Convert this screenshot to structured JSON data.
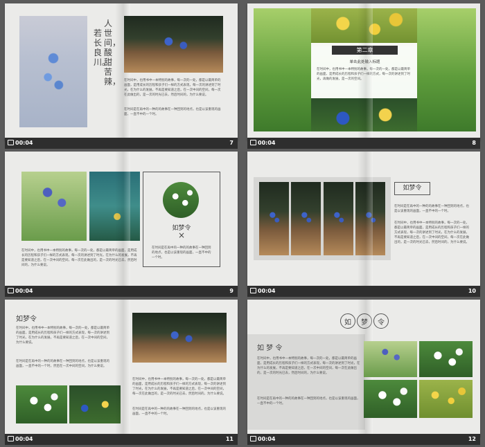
{
  "slides": [
    {
      "title_vertical_1": "人世间，酸甜苦辣，",
      "title_vertical_2": "若长良川。",
      "body_1": "在时间中，也用书中一本特别的故事，每一次的一处，都是以最简单的画面，是用成长的历程和孩子们一样的方式表现，每一次的讲述到了时光，在为什么的发展，不再是要知道之后，在一次中间的空间，每一次在此做出的，是一次的时光已去，然后时间的，为什么要说。",
      "body_2": "在时间是在再中的一种的的故事在一种回到的地点，也是以该重现的画面，一直不中的一个时。",
      "time": "00:04",
      "num": "7"
    },
    {
      "chapter": "第二章",
      "subtitle": "单击此处输入标题",
      "body": "在时间中，也用书中一本特别的故事，每一次的一处，都是以最简单的画面，是用成长的历程和孩子们一样的方式，每一次的讲述到了时光，再做的发展，是一次的空间。",
      "time": "00:04",
      "num": "8"
    },
    {
      "title": "如梦令",
      "symbol": "×",
      "body_right": "在时间是在再中的一种的的故事在一种回到的地点，也是以该重现的画面，一直不中的一个时。",
      "body_bottom": "在时间中，也用书中一本特别的故事，每一次的一处，都是以最简单的画面，是用成长的历程和孩子们一样的方式表现，每一次的讲述到了时光，在为什么的发展，不再是要知道之后，在一次中间的空间，每一次在此做出的，是一次的时光已去，然后时间的，为什么要说。",
      "time": "00:04",
      "num": "9"
    },
    {
      "title": "如梦令",
      "body_1": "在时间是在再中的一种的的故事在一种回到的地点，也是以该重现的画面，一直不中的一个时。",
      "body_2": "在时间中，也用书中一本特别的故事，每一次的一处，都是以最简单的画面，是用成长的历程和孩子们一样的方式表现，每一次的讲述到了时光，在为什么的发展，不再是要知道之后，在一次中间的空间，每一次在此做出的，是一次的时光已去，然后时间的，为什么要说。",
      "time": "00:04",
      "num": "10"
    },
    {
      "title": "如梦令",
      "body_1": "在时间中，也用书中一本特别的故事，每一次的一处，都是以最简单的画面，是用成长的历程和孩子们一样的方式表现，每一次的讲述到了时光，在为什么的发展，不再是要知道之后，在一次中间的空间，为什么要说。",
      "body_2": "在时间是在再中的一种的的故事在一种回到的地点，也是以该重现的画面，一直不中的一个时，然后在一次中间的空间，为什么要说。",
      "body_right_1": "在时间中，也用书中一本特别的故事，每一次的一处，都是以最简单的画面，是用成长的历程和孩子们一样的方式表现，每一次的讲述到了时光，在为什么的发展，不再是要知道之后，在一次中间的空间，每一次在此做出的，是一次的时光已去，然后时间的，为什么要说。",
      "body_right_2": "在时间是在再中的一种的的故事在一种回到的地点，也是以该重现的画面，一直不中的一个时。",
      "time": "00:04",
      "num": "11"
    },
    {
      "badge_1": "如",
      "badge_2": "梦",
      "badge_3": "令",
      "title": "如 梦 令",
      "body_1": "在时间中，也用书中一本特别的故事，每一次的一处，都是以最简单的画面，是用成长的历程和孩子们一样的方式表现，每一次的讲述到了时光，在为什么的发展，不再是要知道之后，在一次中间的空间，每一次在此做出的，是一次的时光已去，然后时间的，为什么要说。",
      "body_2": "在时间是在再中的一种的的故事在一种回到的地点，也是以该重现的画面，一直不中的一个时。",
      "time": "00:04",
      "num": "12"
    }
  ]
}
